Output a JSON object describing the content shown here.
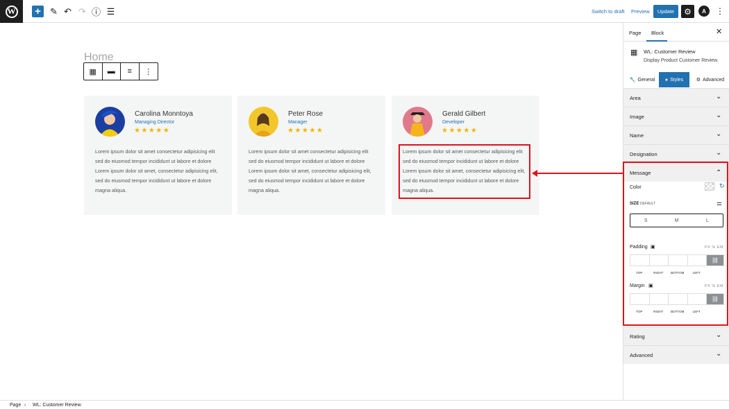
{
  "toolbar": {
    "switch_to_draft": "Switch to draft",
    "preview": "Preview",
    "update": "Update"
  },
  "canvas": {
    "page_title": "Home",
    "cards": [
      {
        "name": "Carolina Monntoya",
        "designation": "Managing Director",
        "stars": "★★★★★",
        "message": "Lorem ipsum dolor sit amet consectetur adipisicing elit sed do eiusmod tempor incididunt ut labore et dolore Lorem ipsum dolor sit amet, consectetur adipisicing elit, sed do eiusmod tempor incididunt ut labore et dolore magna aliqua."
      },
      {
        "name": "Peter Rose",
        "designation": "Manager",
        "stars": "★★★★★",
        "message": "Lorem ipsum dolor sit amet consectetur adipisicing elit sed do eiusmod tempor incididunt ut labore et dolore Lorem ipsum dolor sit amet, consectetur adipisicing elit, sed do eiusmod tempor incididunt ut labore et dolore magna aliqua."
      },
      {
        "name": "Gerald Gilbert",
        "designation": "Developer",
        "stars": "★★★★★",
        "message": "Lorem ipsum dolor sit amet consectetur adipisicing elit sed do eiusmod tempor incididunt ut labore et dolore Lorem ipsum dolor sit amet, consectetur adipisicing elit, sed do eiusmod tempor incididunt ut labore et dolore magna aliqua."
      }
    ]
  },
  "sidebar": {
    "tabs": [
      "Page",
      "Block"
    ],
    "block_title": "WL: Customer Review",
    "block_desc": "Display Product Customer Review.",
    "style_tabs": [
      "General",
      "Styles",
      "Advanced"
    ],
    "panels": [
      "Area",
      "Image",
      "Name",
      "Designation",
      "Message",
      "Rating",
      "Advanced"
    ],
    "message": {
      "color_label": "Color",
      "size_label": "SIZE",
      "size_default": "DEFAULT",
      "sizes": [
        "S",
        "M",
        "L"
      ],
      "padding_label": "Padding",
      "margin_label": "Margin",
      "units": "PX % EM",
      "sides": [
        "TOP",
        "RIGHT",
        "BOTTOM",
        "LEFT"
      ]
    }
  },
  "footer": {
    "crumb_1": "Page",
    "crumb_2": "WL: Customer Review"
  },
  "colors": {
    "accent": "#2271b1",
    "highlight": "#e0101a",
    "star": "#f0b400"
  }
}
